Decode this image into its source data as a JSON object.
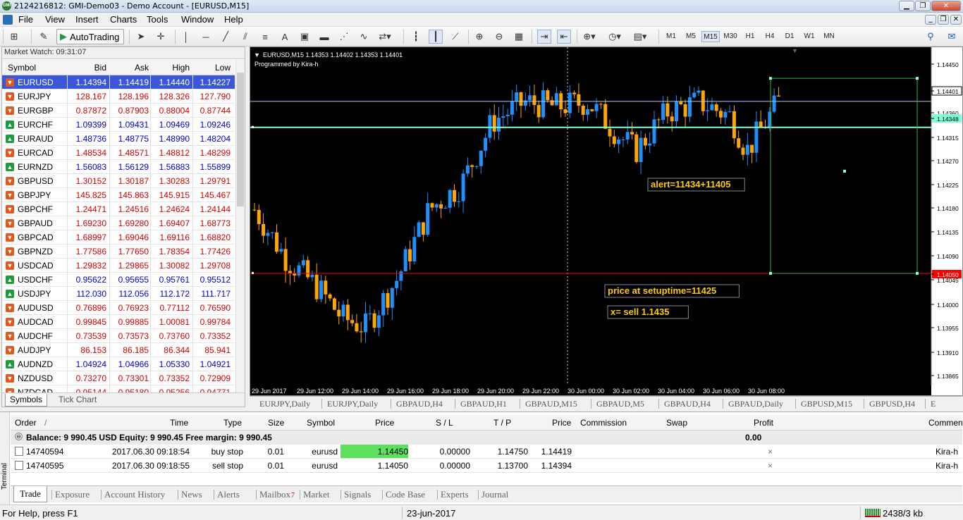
{
  "titlebar": {
    "title": "2124216812: GMI-Demo03 - Demo Account - [EURUSD,M15]"
  },
  "menu": [
    "File",
    "View",
    "Insert",
    "Charts",
    "Tools",
    "Window",
    "Help"
  ],
  "toolbar": {
    "autotrading": "AutoTrading",
    "timeframes": [
      "M1",
      "M5",
      "M15",
      "M30",
      "H1",
      "H4",
      "D1",
      "W1",
      "MN"
    ],
    "active_timeframe": "M15"
  },
  "market_watch": {
    "title": "Market Watch: 09:31:07",
    "headers": [
      "Symbol",
      "Bid",
      "Ask",
      "High",
      "Low"
    ],
    "rows": [
      {
        "symbol": "EURUSD",
        "bid": "1.14394",
        "ask": "1.14419",
        "high": "1.14440",
        "low": "1.14227",
        "dir": "dn",
        "color": "#ffffff",
        "selected": true
      },
      {
        "symbol": "EURJPY",
        "bid": "128.167",
        "ask": "128.196",
        "high": "128.326",
        "low": "127.790",
        "dir": "dn",
        "color": "#d40000"
      },
      {
        "symbol": "EURGBP",
        "bid": "0.87872",
        "ask": "0.87903",
        "high": "0.88004",
        "low": "0.87744",
        "dir": "dn",
        "color": "#d40000"
      },
      {
        "symbol": "EURCHF",
        "bid": "1.09399",
        "ask": "1.09431",
        "high": "1.09469",
        "low": "1.09246",
        "dir": "up",
        "color": "#0000d8"
      },
      {
        "symbol": "EURAUD",
        "bid": "1.48736",
        "ask": "1.48775",
        "high": "1.48990",
        "low": "1.48204",
        "dir": "up",
        "color": "#0000d8"
      },
      {
        "symbol": "EURCAD",
        "bid": "1.48534",
        "ask": "1.48571",
        "high": "1.48812",
        "low": "1.48299",
        "dir": "dn",
        "color": "#d40000"
      },
      {
        "symbol": "EURNZD",
        "bid": "1.56083",
        "ask": "1.56129",
        "high": "1.56883",
        "low": "1.55899",
        "dir": "up",
        "color": "#0000d8"
      },
      {
        "symbol": "GBPUSD",
        "bid": "1.30152",
        "ask": "1.30187",
        "high": "1.30283",
        "low": "1.29791",
        "dir": "dn",
        "color": "#d40000"
      },
      {
        "symbol": "GBPJPY",
        "bid": "145.825",
        "ask": "145.863",
        "high": "145.915",
        "low": "145.467",
        "dir": "dn",
        "color": "#d40000"
      },
      {
        "symbol": "GBPCHF",
        "bid": "1.24471",
        "ask": "1.24516",
        "high": "1.24624",
        "low": "1.24144",
        "dir": "dn",
        "color": "#d40000"
      },
      {
        "symbol": "GBPAUD",
        "bid": "1.69230",
        "ask": "1.69280",
        "high": "1.69407",
        "low": "1.68773",
        "dir": "dn",
        "color": "#d40000"
      },
      {
        "symbol": "GBPCAD",
        "bid": "1.68997",
        "ask": "1.69046",
        "high": "1.69116",
        "low": "1.68820",
        "dir": "dn",
        "color": "#d40000"
      },
      {
        "symbol": "GBPNZD",
        "bid": "1.77586",
        "ask": "1.77650",
        "high": "1.78354",
        "low": "1.77426",
        "dir": "dn",
        "color": "#d40000"
      },
      {
        "symbol": "USDCAD",
        "bid": "1.29832",
        "ask": "1.29865",
        "high": "1.30082",
        "low": "1.29708",
        "dir": "dn",
        "color": "#d40000"
      },
      {
        "symbol": "USDCHF",
        "bid": "0.95622",
        "ask": "0.95655",
        "high": "0.95761",
        "low": "0.95512",
        "dir": "up",
        "color": "#0000d8"
      },
      {
        "symbol": "USDJPY",
        "bid": "112.030",
        "ask": "112.056",
        "high": "112.172",
        "low": "111.717",
        "dir": "up",
        "color": "#0000d8"
      },
      {
        "symbol": "AUDUSD",
        "bid": "0.76896",
        "ask": "0.76923",
        "high": "0.77112",
        "low": "0.76590",
        "dir": "dn",
        "color": "#d40000"
      },
      {
        "symbol": "AUDCAD",
        "bid": "0.99845",
        "ask": "0.99885",
        "high": "1.00081",
        "low": "0.99784",
        "dir": "dn",
        "color": "#d40000"
      },
      {
        "symbol": "AUDCHF",
        "bid": "0.73539",
        "ask": "0.73573",
        "high": "0.73760",
        "low": "0.73352",
        "dir": "dn",
        "color": "#d40000"
      },
      {
        "symbol": "AUDJPY",
        "bid": "86.153",
        "ask": "86.185",
        "high": "86.344",
        "low": "85.941",
        "dir": "dn",
        "color": "#d40000"
      },
      {
        "symbol": "AUDNZD",
        "bid": "1.04924",
        "ask": "1.04966",
        "high": "1.05330",
        "low": "1.04921",
        "dir": "up",
        "color": "#0000d8"
      },
      {
        "symbol": "NZDUSD",
        "bid": "0.73270",
        "ask": "0.73301",
        "high": "0.73352",
        "low": "0.72909",
        "dir": "dn",
        "color": "#d40000"
      },
      {
        "symbol": "NZDCAD",
        "bid": "0.95144",
        "ask": "0.95180",
        "high": "0.95256",
        "low": "0.94771",
        "dir": "dn",
        "color": "#d40000"
      }
    ],
    "tabs": [
      "Symbols",
      "Tick Chart"
    ]
  },
  "chart": {
    "header": "EURUSD,M15  1.14353 1.14402 1.14353 1.14401",
    "subheader": "Programmed by Kira-h",
    "price_labels": [
      "1.14450",
      "1.14401",
      "1.14360",
      "1.14348",
      "1.14315",
      "1.14270",
      "1.14225",
      "1.14180",
      "1.14135",
      "1.14090",
      "1.14050",
      "1.14045",
      "1.14000",
      "1.13955",
      "1.13910",
      "1.13865"
    ],
    "time_labels": [
      "29 Jun 2017",
      "29 Jun 12:00",
      "29 Jun 14:00",
      "29 Jun 16:00",
      "29 Jun 18:00",
      "29 Jun 20:00",
      "29 Jun 22:00",
      "30 Jun 00:00",
      "30 Jun 02:00",
      "30 Jun 04:00",
      "30 Jun 06:00",
      "30 Jun 08:00"
    ],
    "annotations": [
      "alert=11434+11405",
      "price at setuptime=11425",
      "x= sell 1.1435"
    ],
    "colors": {
      "bull": "#1e90ff",
      "bear": "#ffa500",
      "buy_line": "#7fffd4",
      "sell_line": "#ff0000",
      "box": "#3cb043",
      "note": "#ffcc00",
      "bid_line": "#a8c8ff"
    }
  },
  "chart_data": {
    "type": "candlestick",
    "symbol": "EURUSD",
    "timeframe": "M15",
    "ylim": [
      1.1383,
      1.145
    ],
    "horizontal_lines": [
      1.14348,
      1.1405,
      1.14401
    ]
  },
  "chart_tabs": [
    "EURJPY,Daily",
    "EURJPY,Daily",
    "GBPAUD,H4",
    "GBPAUD,H1",
    "GBPAUD,M15",
    "GBPAUD,M5",
    "GBPAUD,H4",
    "GBPAUD,Daily",
    "GBPUSD,M15",
    "GBPUSD,H4",
    "E"
  ],
  "terminal": {
    "side_label": "Terminal",
    "headers": [
      "Order",
      "/",
      "Time",
      "Type",
      "Size",
      "Symbol",
      "Price",
      "S / L",
      "T / P",
      "Price",
      "Commission",
      "Swap",
      "Profit",
      "Comment"
    ],
    "balance": "Balance: 9 990.45 USD  Equity: 9 990.45  Free margin: 9 990.45",
    "balance_profit": "0.00",
    "orders": [
      {
        "order": "14740594",
        "time": "2017.06.30 09:18:54",
        "type": "buy stop",
        "size": "0.01",
        "symbol": "eurusd",
        "price": "1.14450",
        "sl": "0.00000",
        "tp": "1.14750",
        "cur": "1.14419",
        "close": "×",
        "comment": "Kira-h"
      },
      {
        "order": "14740595",
        "time": "2017.06.30 09:18:55",
        "type": "sell stop",
        "size": "0.01",
        "symbol": "eurusd",
        "price": "1.14050",
        "sl": "0.00000",
        "tp": "1.13700",
        "cur": "1.14394",
        "close": "×",
        "comment": "Kira-h"
      }
    ],
    "tabs": [
      "Trade",
      "Exposure",
      "Account History",
      "News",
      "Alerts",
      "Mailbox",
      "Market",
      "Signals",
      "Code Base",
      "Experts",
      "Journal"
    ],
    "mailbox_count": "7"
  },
  "status": {
    "help": "For Help, press F1",
    "date": "23-jun-2017",
    "traffic": "2438/3 kb"
  }
}
